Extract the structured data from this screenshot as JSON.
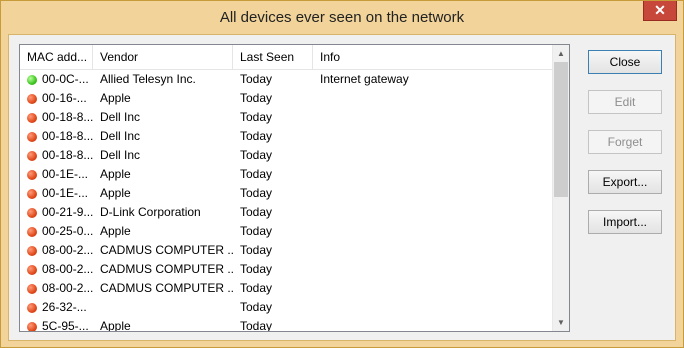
{
  "window": {
    "title": "All devices ever seen on the network",
    "close_glyph": "✕"
  },
  "list": {
    "columns": [
      "MAC add...",
      "Vendor",
      "Last Seen",
      "Info"
    ],
    "rows": [
      {
        "status": "green",
        "mac": "00-0C-...",
        "vendor": "Allied Telesyn Inc.",
        "last_seen": "Today",
        "info": "Internet gateway"
      },
      {
        "status": "red",
        "mac": "00-16-...",
        "vendor": "Apple",
        "last_seen": "Today",
        "info": ""
      },
      {
        "status": "red",
        "mac": "00-18-8...",
        "vendor": "Dell Inc",
        "last_seen": "Today",
        "info": ""
      },
      {
        "status": "red",
        "mac": "00-18-8...",
        "vendor": "Dell Inc",
        "last_seen": "Today",
        "info": ""
      },
      {
        "status": "red",
        "mac": "00-18-8...",
        "vendor": "Dell Inc",
        "last_seen": "Today",
        "info": ""
      },
      {
        "status": "red",
        "mac": "00-1E-...",
        "vendor": "Apple",
        "last_seen": "Today",
        "info": ""
      },
      {
        "status": "red",
        "mac": "00-1E-...",
        "vendor": "Apple",
        "last_seen": "Today",
        "info": ""
      },
      {
        "status": "red",
        "mac": "00-21-9...",
        "vendor": "D-Link Corporation",
        "last_seen": "Today",
        "info": ""
      },
      {
        "status": "red",
        "mac": "00-25-0...",
        "vendor": "Apple",
        "last_seen": "Today",
        "info": ""
      },
      {
        "status": "red",
        "mac": "08-00-2...",
        "vendor": "CADMUS COMPUTER ...",
        "last_seen": "Today",
        "info": ""
      },
      {
        "status": "red",
        "mac": "08-00-2...",
        "vendor": "CADMUS COMPUTER ...",
        "last_seen": "Today",
        "info": ""
      },
      {
        "status": "red",
        "mac": "08-00-2...",
        "vendor": "CADMUS COMPUTER ...",
        "last_seen": "Today",
        "info": ""
      },
      {
        "status": "red",
        "mac": "26-32-...",
        "vendor": "",
        "last_seen": "Today",
        "info": ""
      },
      {
        "status": "red",
        "mac": "5C-95-...",
        "vendor": "Apple",
        "last_seen": "Today",
        "info": ""
      }
    ]
  },
  "buttons": {
    "close": "Close",
    "edit": "Edit",
    "forget": "Forget",
    "export": "Export...",
    "import": "Import..."
  },
  "colors": {
    "status_online": "#3cc51e",
    "status_offline": "#e04a1a",
    "frame": "#f2d49a"
  },
  "icons": {
    "scroll_up": "up-arrow-icon",
    "scroll_down": "down-arrow-icon"
  }
}
